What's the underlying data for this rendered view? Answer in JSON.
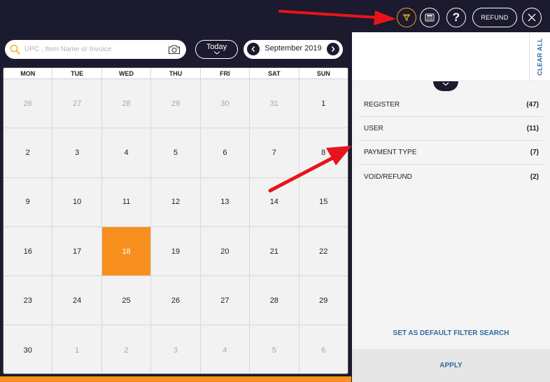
{
  "toolbar": {
    "refund_label": "REFUND",
    "help_label": "?"
  },
  "search": {
    "placeholder": "UPC , Item Name or Invoice",
    "value": ""
  },
  "calendar": {
    "today_label": "Today",
    "month_label": "September 2019",
    "weekdays": [
      "MON",
      "TUE",
      "WED",
      "THU",
      "FRI",
      "SAT",
      "SUN"
    ],
    "weeks": [
      [
        {
          "d": "26",
          "m": true
        },
        {
          "d": "27",
          "m": true
        },
        {
          "d": "28",
          "m": true
        },
        {
          "d": "29",
          "m": true
        },
        {
          "d": "30",
          "m": true
        },
        {
          "d": "31",
          "m": true
        },
        {
          "d": "1",
          "m": false
        }
      ],
      [
        {
          "d": "2",
          "m": false
        },
        {
          "d": "3",
          "m": false
        },
        {
          "d": "4",
          "m": false
        },
        {
          "d": "5",
          "m": false
        },
        {
          "d": "6",
          "m": false
        },
        {
          "d": "7",
          "m": false
        },
        {
          "d": "8",
          "m": false
        }
      ],
      [
        {
          "d": "9",
          "m": false
        },
        {
          "d": "10",
          "m": false
        },
        {
          "d": "11",
          "m": false
        },
        {
          "d": "12",
          "m": false
        },
        {
          "d": "13",
          "m": false
        },
        {
          "d": "14",
          "m": false
        },
        {
          "d": "15",
          "m": false
        }
      ],
      [
        {
          "d": "16",
          "m": false
        },
        {
          "d": "17",
          "m": false
        },
        {
          "d": "18",
          "m": false,
          "s": true
        },
        {
          "d": "19",
          "m": false
        },
        {
          "d": "20",
          "m": false
        },
        {
          "d": "21",
          "m": false
        },
        {
          "d": "22",
          "m": false
        }
      ],
      [
        {
          "d": "23",
          "m": false
        },
        {
          "d": "24",
          "m": false
        },
        {
          "d": "25",
          "m": false
        },
        {
          "d": "26",
          "m": false
        },
        {
          "d": "27",
          "m": false
        },
        {
          "d": "28",
          "m": false
        },
        {
          "d": "29",
          "m": false
        }
      ],
      [
        {
          "d": "30",
          "m": false
        },
        {
          "d": "1",
          "m": true
        },
        {
          "d": "2",
          "m": true
        },
        {
          "d": "3",
          "m": true
        },
        {
          "d": "4",
          "m": true
        },
        {
          "d": "5",
          "m": true
        },
        {
          "d": "6",
          "m": true
        }
      ]
    ],
    "selected_color": "#f7901e"
  },
  "filters": {
    "clear_all_label": "CLEAR ALL",
    "items": [
      {
        "label": "REGISTER",
        "count": "(47)"
      },
      {
        "label": "USER",
        "count": "(11)"
      },
      {
        "label": "PAYMENT TYPE",
        "count": "(7)"
      },
      {
        "label": "VOID/REFUND",
        "count": "(2)"
      }
    ],
    "default_label": "SET AS DEFAULT FILTER SEARCH",
    "apply_label": "APPLY"
  },
  "colors": {
    "navy": "#1b1a2e",
    "accent": "#f7a51c",
    "link_blue": "#2f6aa3",
    "annotation_red": "#e8141b"
  },
  "icons": {
    "filter": "funnel-icon",
    "calculator": "calculator-icon",
    "close": "close-icon",
    "search": "search-icon",
    "camera": "camera-icon"
  }
}
